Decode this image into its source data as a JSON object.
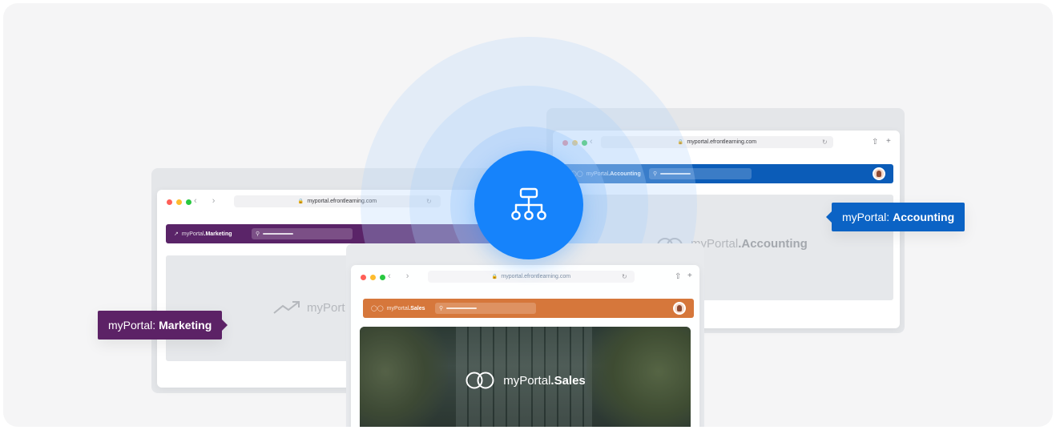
{
  "marketing_window": {
    "url": "myportal.efrontlearning.com",
    "brand_prefix": "myPortal",
    "brand_name": ".Marketing",
    "wordmark_prefix": "myPort",
    "accent_color": "#5c2266"
  },
  "accounting_window": {
    "url": "myportal.efrontlearning.com",
    "brand_prefix": "myPortal",
    "brand_name": ".Accounting",
    "wordmark_prefix": "myPortal",
    "wordmark_name": ".Accounting",
    "accent_color": "#0b63c5"
  },
  "sales_window": {
    "url": "myportal.efrontlearning.com",
    "brand_prefix": "myPortal",
    "brand_name": ".Sales",
    "wordmark_prefix": "myPortal",
    "wordmark_name": ".Sales",
    "accent_color": "#d9783c"
  },
  "badges": {
    "marketing": {
      "prefix": "myPortal:",
      "name": "Marketing"
    },
    "accounting": {
      "prefix": "myPortal:",
      "name": "Accounting"
    }
  },
  "hub": {
    "icon": "org-hierarchy-icon",
    "color": "#1683fb"
  },
  "icons": {
    "lock": "🔒",
    "reload": "↻",
    "search": "⚲",
    "share": "⇧",
    "plus": "+",
    "nav": "‹ ›"
  }
}
